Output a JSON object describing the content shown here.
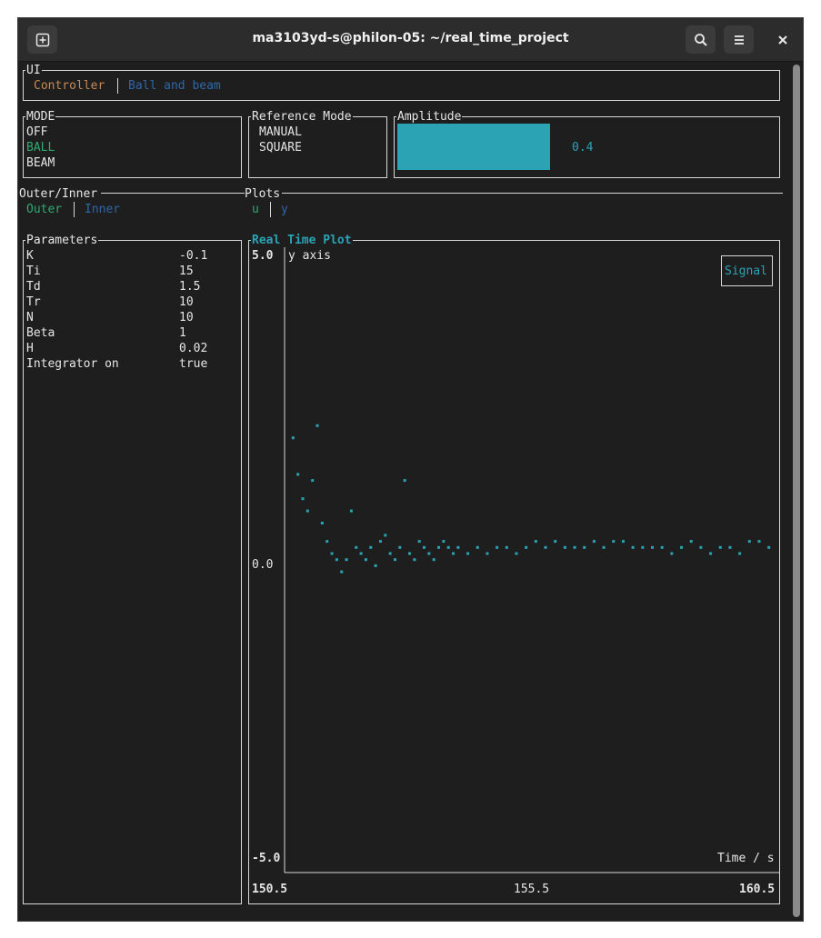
{
  "window": {
    "title": "ma3103yd-s@philon-05: ~/real_time_project"
  },
  "ui_tabs": {
    "label": "UI",
    "tabs": [
      "Controller",
      "Ball and beam"
    ]
  },
  "mode": {
    "label": "MODE",
    "items": [
      "OFF",
      "BALL",
      "BEAM"
    ],
    "selected": "BALL"
  },
  "reference_mode": {
    "label": "Reference Mode",
    "items": [
      "MANUAL",
      "SQUARE"
    ]
  },
  "amplitude": {
    "label": "Amplitude",
    "value": "0.4",
    "fraction": 0.4
  },
  "outer_inner": {
    "label": "Outer/Inner",
    "tabs": [
      "Outer",
      "Inner"
    ]
  },
  "plots": {
    "label": "Plots",
    "tabs": [
      "u",
      "y"
    ]
  },
  "parameters": {
    "label": "Parameters",
    "rows": [
      {
        "name": "K",
        "value": "-0.1"
      },
      {
        "name": "Ti",
        "value": "15"
      },
      {
        "name": "Td",
        "value": "1.5"
      },
      {
        "name": "Tr",
        "value": "10"
      },
      {
        "name": "N",
        "value": "10"
      },
      {
        "name": "Beta",
        "value": "1"
      },
      {
        "name": "H",
        "value": "0.02"
      },
      {
        "name": "Integrator on",
        "value": "true"
      }
    ]
  },
  "chart_data": {
    "type": "scatter",
    "title": "Real Time Plot",
    "ylabel": "y axis",
    "xlabel": "Time / s",
    "legend": [
      "Signal"
    ],
    "legend_position": "top-right",
    "xlim": [
      150.5,
      160.5
    ],
    "ylim": [
      -5.0,
      5.0
    ],
    "x_ticks": [
      "150.5",
      "155.5",
      "160.5"
    ],
    "y_ticks": [
      "5.0",
      "0.0",
      "-5.0"
    ],
    "series": [
      {
        "name": "Signal",
        "color": "#2ba3b5",
        "x": [
          150.6,
          150.7,
          150.8,
          150.9,
          151.0,
          151.1,
          151.2,
          151.3,
          151.4,
          151.5,
          151.6,
          151.7,
          151.8,
          151.9,
          152.0,
          152.1,
          152.2,
          152.3,
          152.4,
          152.5,
          152.6,
          152.7,
          152.8,
          152.9,
          153.0,
          153.1,
          153.2,
          153.3,
          153.4,
          153.5,
          153.6,
          153.7,
          153.8,
          153.9,
          154.0,
          154.2,
          154.4,
          154.6,
          154.8,
          155.0,
          155.2,
          155.4,
          155.6,
          155.8,
          156.0,
          156.2,
          156.4,
          156.6,
          156.8,
          157.0,
          157.2,
          157.4,
          157.6,
          157.8,
          158.0,
          158.2,
          158.4,
          158.6,
          158.8,
          159.0,
          159.2,
          159.4,
          159.6,
          159.8,
          160.0,
          160.2,
          160.4
        ],
        "y": [
          1.9,
          1.3,
          0.9,
          0.7,
          1.2,
          2.1,
          0.5,
          0.2,
          0.0,
          -0.1,
          -0.3,
          -0.1,
          0.7,
          0.1,
          0.0,
          -0.1,
          0.1,
          -0.2,
          0.2,
          0.3,
          0.0,
          -0.1,
          0.1,
          1.2,
          0.0,
          -0.1,
          0.2,
          0.1,
          0.0,
          -0.1,
          0.1,
          0.2,
          0.1,
          0.0,
          0.1,
          0.0,
          0.1,
          0.0,
          0.1,
          0.1,
          0.0,
          0.1,
          0.2,
          0.1,
          0.2,
          0.1,
          0.1,
          0.1,
          0.2,
          0.1,
          0.2,
          0.2,
          0.1,
          0.1,
          0.1,
          0.1,
          0.0,
          0.1,
          0.2,
          0.1,
          0.0,
          0.1,
          0.1,
          0.0,
          0.2,
          0.2,
          0.1
        ]
      }
    ]
  }
}
